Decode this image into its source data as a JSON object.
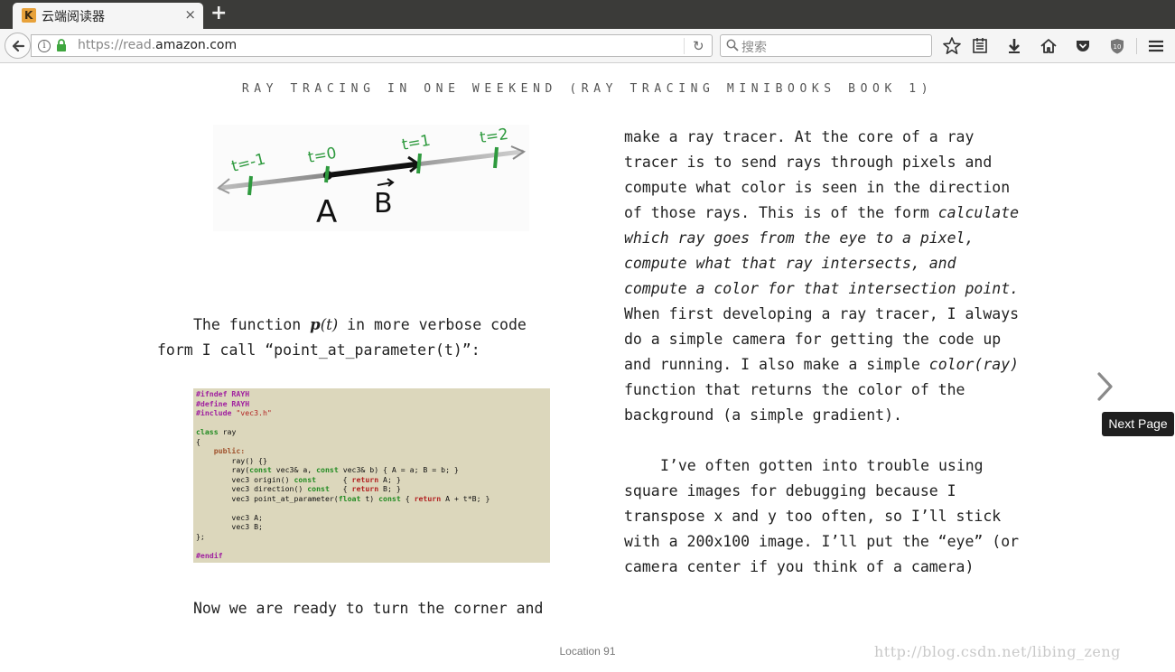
{
  "browser": {
    "tab_title": "云端阅读器",
    "tab_close": "×",
    "new_tab": "+",
    "url_prefix": "https://read.",
    "url_domain": "amazon.com",
    "search_placeholder": "搜索",
    "reload_glyph": "↻"
  },
  "book": {
    "title": "RAY TRACING IN ONE WEEKEND (RAY TRACING MINIBOOKS BOOK 1)",
    "diagram_labels": {
      "t_minus_1": "t=-1",
      "t_0": "t=0",
      "t_1": "t=1",
      "t_2": "t=2",
      "point_a": "A",
      "vector_b": "B"
    },
    "left_para_1_a": "The function ",
    "left_para_1_fn": "p",
    "left_para_1_arg": "(t)",
    "left_para_1_b": " in more verbose code form I call ",
    "left_para_1_code": "“point_at_parameter(t)”",
    "left_para_1_c": ":",
    "code_lines": {
      "l1": "#ifndef RAYH",
      "l2": "#define RAYH",
      "l3a": "#include ",
      "l3b": "\"vec3.h\"",
      "l5a": "class",
      "l5b": " ray",
      "l6": "{",
      "l7": "public:",
      "l8": "        ray() {}",
      "l9a": "        ray(",
      "l9b": "const",
      "l9c": " vec3& a, ",
      "l9d": "const",
      "l9e": " vec3& b) { A = a; B = b; }",
      "l10a": "        vec3 origin() ",
      "l10b": "const",
      "l10c": "      { ",
      "l10d": "return",
      "l10e": " A; }",
      "l11a": "        vec3 direction() ",
      "l11b": "const",
      "l11c": "   { ",
      "l11d": "return",
      "l11e": " B; }",
      "l12a": "        vec3 point_at_parameter(",
      "l12b": "float",
      "l12c": " t) ",
      "l12d": "const",
      "l12e": " { ",
      "l12f": "return",
      "l12g": " A + t*B; }",
      "l14": "        vec3 A;",
      "l15": "        vec3 B;",
      "l16": "};",
      "l18": "#endif"
    },
    "left_para_2": "Now we are ready to turn the corner and",
    "right_para_1_a": "make a ray tracer.  At the core of a ray tracer is to send rays through pixels and compute what color is seen in the direction of those rays.  This is of the form ",
    "right_para_1_em": "calculate which ray goes from the eye to a pixel, compute what that ray intersects, and compute a color for that intersection point.",
    "right_para_1_b": "  When first developing a ray tracer, I always do a simple camera for getting the code up and running. I also make a simple ",
    "right_para_1_em2": "color(ray)",
    "right_para_1_c": " function that returns the color of the background (a simple gradient).",
    "right_para_2": "I’ve often gotten into trouble using square images for debugging because I transpose x and y too often, so I’ll stick with a 200x100 image. I’ll put the “eye” (or camera center if you think of a camera)",
    "next_page_tooltip": "Next Page",
    "location": "Location 91"
  },
  "watermark": "http://blog.csdn.net/libing_zeng",
  "colors": {
    "tabbar": "#3b3b39",
    "code_bg": "#dcd7bc",
    "diagram_green": "#2e9a3e"
  }
}
